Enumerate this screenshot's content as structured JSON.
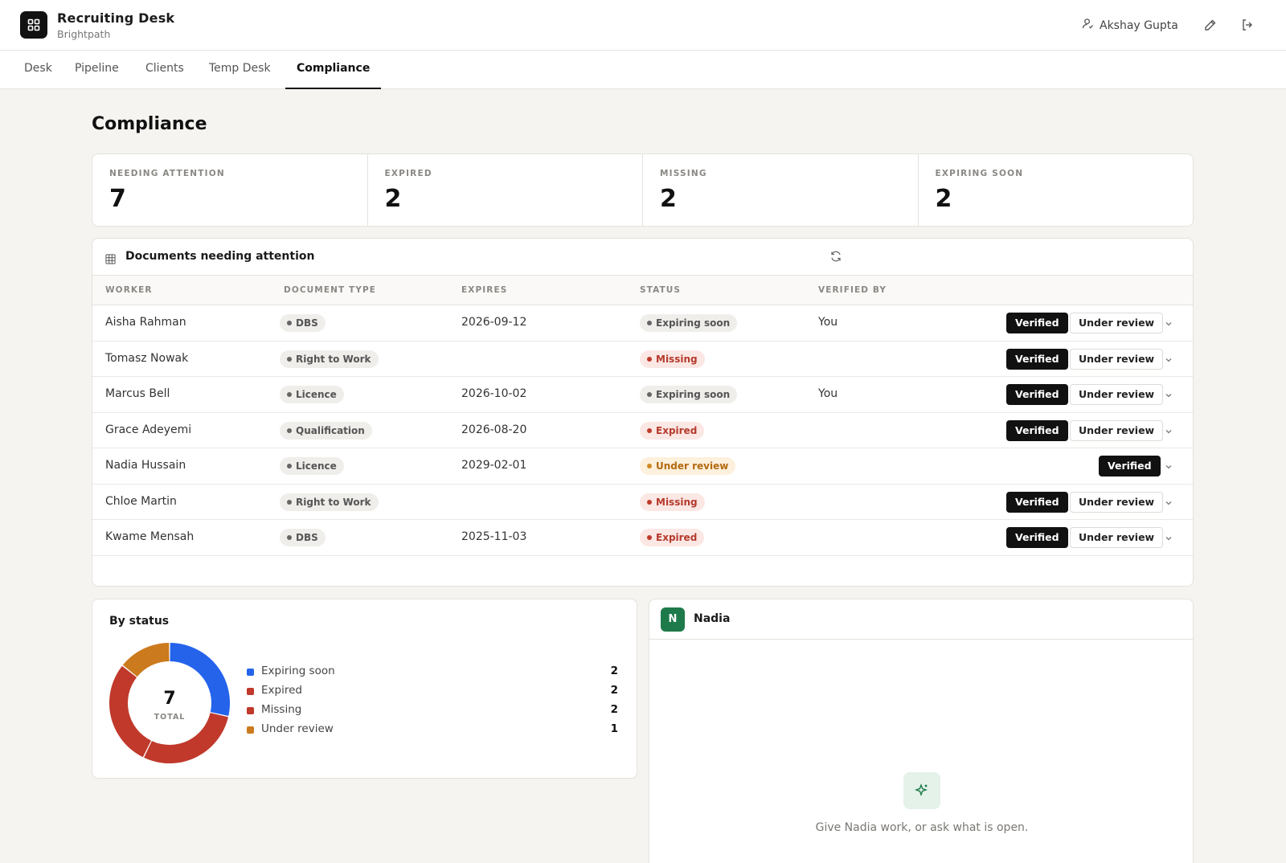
{
  "app": {
    "title": "Recruiting Desk",
    "subtitle": "Brightpath"
  },
  "user": {
    "name": "Akshay Gupta"
  },
  "icons": {
    "logo": "grid-icon",
    "user": "user-icon",
    "edit": "pencil-icon",
    "logout": "logout-icon",
    "refresh": "refresh-icon",
    "table": "table-icon",
    "assistant": "sparkle-icon"
  },
  "tabs": [
    {
      "label": "Desk"
    },
    {
      "label": "Pipeline"
    },
    {
      "label": "Clients"
    },
    {
      "label": "Temp Desk"
    },
    {
      "label": "Compliance",
      "active": true
    }
  ],
  "page": {
    "title": "Compliance"
  },
  "stats": [
    {
      "label": "NEEDING ATTENTION",
      "value": "7"
    },
    {
      "label": "EXPIRED",
      "value": "2"
    },
    {
      "label": "MISSING",
      "value": "2"
    },
    {
      "label": "EXPIRING SOON",
      "value": "2"
    }
  ],
  "documents": {
    "title": "Documents needing attention",
    "columns": [
      "WORKER",
      "DOCUMENT TYPE",
      "EXPIRES",
      "STATUS",
      "VERIFIED BY"
    ],
    "verified_label": "Verified",
    "review_label": "Under review",
    "rows": [
      {
        "worker": "Aisha Rahman",
        "doc_type": "DBS",
        "expires": "2026-09-12",
        "status": "Expiring soon",
        "status_tone": "grey",
        "verified_by": "You",
        "show_review": true
      },
      {
        "worker": "Tomasz Nowak",
        "doc_type": "Right to Work",
        "expires": "",
        "status": "Missing",
        "status_tone": "red",
        "verified_by": "",
        "show_review": true
      },
      {
        "worker": "Marcus Bell",
        "doc_type": "Licence",
        "expires": "2026-10-02",
        "status": "Expiring soon",
        "status_tone": "grey",
        "verified_by": "You",
        "show_review": true
      },
      {
        "worker": "Grace Adeyemi",
        "doc_type": "Qualification",
        "expires": "2026-08-20",
        "status": "Expired",
        "status_tone": "red",
        "verified_by": "",
        "show_review": true
      },
      {
        "worker": "Nadia Hussain",
        "doc_type": "Licence",
        "expires": "2029-02-01",
        "status": "Under review",
        "status_tone": "amber",
        "verified_by": "",
        "show_review": false
      },
      {
        "worker": "Chloe Martin",
        "doc_type": "Right to Work",
        "expires": "",
        "status": "Missing",
        "status_tone": "red",
        "verified_by": "",
        "show_review": true
      },
      {
        "worker": "Kwame Mensah",
        "doc_type": "DBS",
        "expires": "2025-11-03",
        "status": "Expired",
        "status_tone": "red",
        "verified_by": "",
        "show_review": true
      }
    ]
  },
  "by_status": {
    "title": "By status",
    "total": "7",
    "total_label": "TOTAL",
    "items": [
      {
        "name": "Expiring soon",
        "count": 2,
        "color": "#2563eb"
      },
      {
        "name": "Expired",
        "count": 2,
        "color": "#c0392b"
      },
      {
        "name": "Missing",
        "count": 2,
        "color": "#c0392b"
      },
      {
        "name": "Under review",
        "count": 1,
        "color": "#cc7a1e"
      }
    ]
  },
  "assistant": {
    "initial": "N",
    "name": "Nadia",
    "hint": "Give Nadia work, or ask what is open."
  }
}
